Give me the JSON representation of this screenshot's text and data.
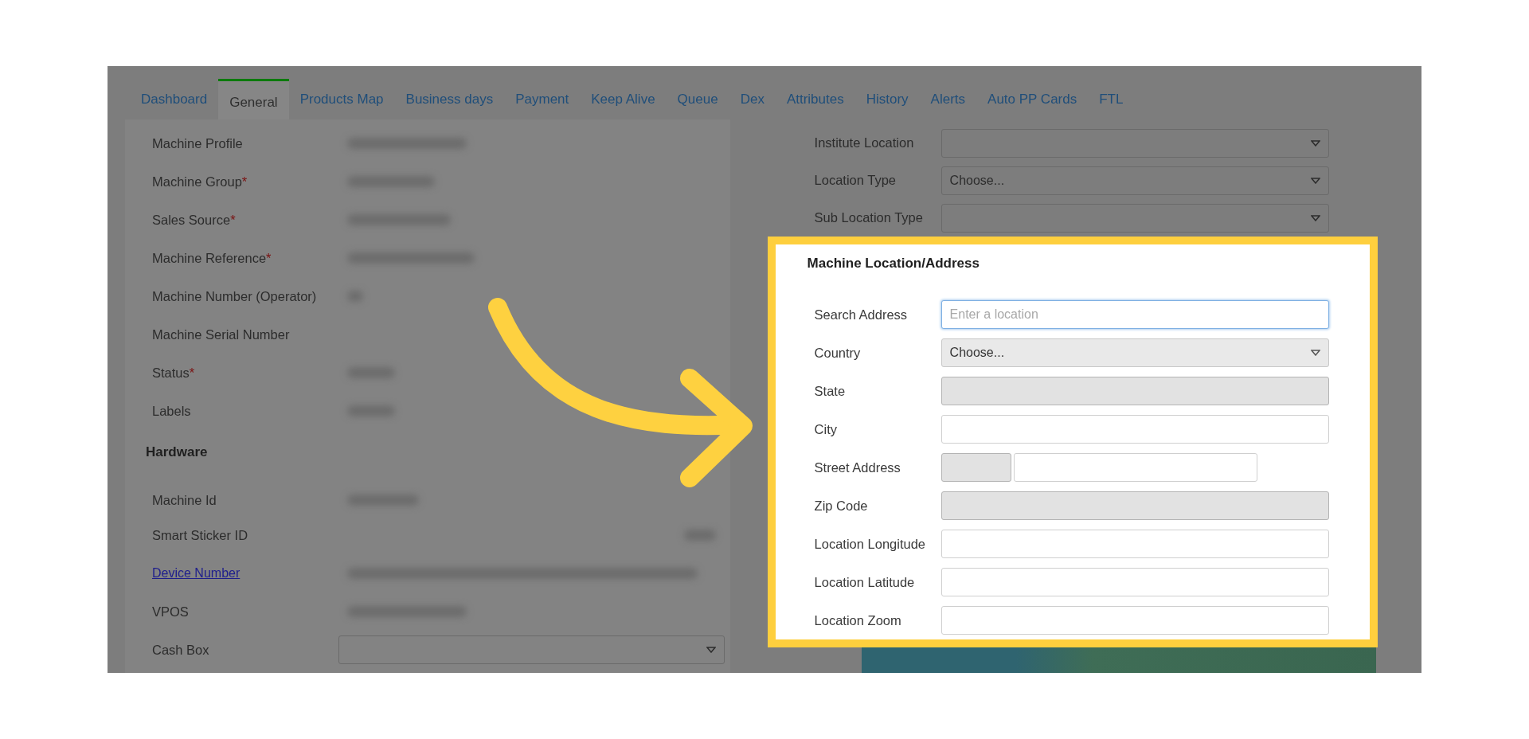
{
  "tabs": [
    {
      "label": "Dashboard",
      "selected": false
    },
    {
      "label": "General",
      "selected": true
    },
    {
      "label": "Products Map",
      "selected": false
    },
    {
      "label": "Business days",
      "selected": false
    },
    {
      "label": "Payment",
      "selected": false
    },
    {
      "label": "Keep Alive",
      "selected": false
    },
    {
      "label": "Queue",
      "selected": false
    },
    {
      "label": "Dex",
      "selected": false
    },
    {
      "label": "Attributes",
      "selected": false
    },
    {
      "label": "History",
      "selected": false
    },
    {
      "label": "Alerts",
      "selected": false
    },
    {
      "label": "Auto PP Cards",
      "selected": false
    },
    {
      "label": "FTL",
      "selected": false
    }
  ],
  "left_form": {
    "fields": [
      {
        "label": "Machine Profile",
        "redacted": true
      },
      {
        "label": "Machine Group",
        "mark": "*",
        "redacted": true
      },
      {
        "label": "Sales Source",
        "mark": "*",
        "redacted": true
      },
      {
        "label": "Machine Reference",
        "mark": "*",
        "redacted": true
      },
      {
        "label": "Machine Number (Operator)",
        "redacted": true
      },
      {
        "label": "Machine Serial Number",
        "redacted": false
      },
      {
        "label": "Status",
        "mark": "*",
        "redacted": true
      },
      {
        "label": "Labels",
        "redacted": true
      }
    ],
    "hardware": {
      "title": "Hardware",
      "fields": [
        {
          "label": "Machine Id",
          "kind": "text",
          "redacted": true
        },
        {
          "label": "Smart Sticker ID",
          "kind": "text",
          "redacted": true
        },
        {
          "label": "Device Number",
          "kind": "link",
          "redacted": true
        },
        {
          "label": "VPOS",
          "kind": "text",
          "redacted": true
        },
        {
          "label": "Cash Box",
          "kind": "select",
          "redacted": false
        }
      ]
    }
  },
  "right_form": {
    "fields": [
      {
        "label": "Institute Location",
        "kind": "select"
      },
      {
        "label": "Location Type",
        "kind": "select",
        "value": "Choose..."
      },
      {
        "label": "Sub Location Type",
        "kind": "select"
      }
    ]
  },
  "location_panel": {
    "title": "Machine Location/Address",
    "fields": [
      {
        "label": "Search Address",
        "kind": "text",
        "placeholder": "Enter a location",
        "focused": true,
        "disabled": false
      },
      {
        "label": "Country",
        "kind": "select",
        "value": "Choose...",
        "focused": false,
        "disabled": true
      },
      {
        "label": "State",
        "kind": "text",
        "focused": false,
        "disabled": true
      },
      {
        "label": "City",
        "kind": "text",
        "focused": false,
        "disabled": false
      },
      {
        "label": "Street Address",
        "kind": "split",
        "focused": false,
        "disabled": false
      },
      {
        "label": "Zip Code",
        "kind": "text",
        "focused": false,
        "disabled": true
      },
      {
        "label": "Location Longitude",
        "kind": "text",
        "focused": false,
        "disabled": false
      },
      {
        "label": "Location Latitude",
        "kind": "text",
        "focused": false,
        "disabled": false
      },
      {
        "label": "Location Zoom",
        "kind": "text",
        "focused": false,
        "disabled": false
      }
    ]
  }
}
